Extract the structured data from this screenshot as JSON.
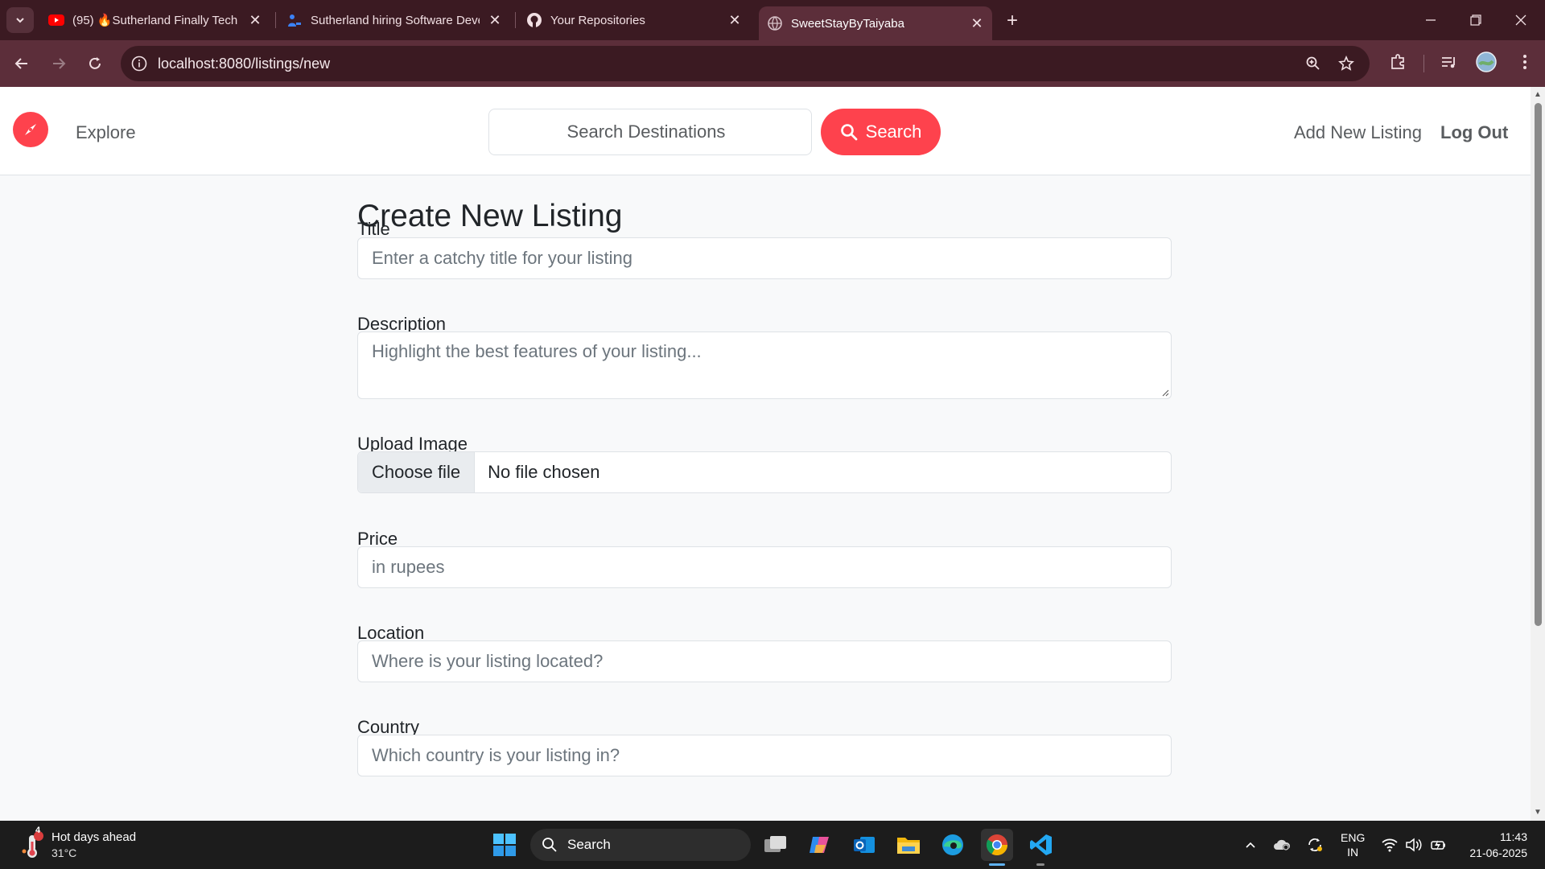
{
  "browser": {
    "tabs": [
      {
        "title": "(95) 🔥Sutherland Finally Tech Hiring",
        "icon": "youtube-icon"
      },
      {
        "title": "Sutherland hiring Software Developer",
        "icon": "job-site-icon"
      },
      {
        "title": "Your Repositories",
        "icon": "github-icon"
      },
      {
        "title": "SweetStayByTaiyaba",
        "icon": "globe-icon"
      }
    ],
    "url": "localhost:8080/listings/new"
  },
  "navbar": {
    "explore": "Explore",
    "search_placeholder": "Search Destinations",
    "search_button": "Search",
    "add_listing": "Add New Listing",
    "logout": "Log Out"
  },
  "form": {
    "heading": "Create New Listing",
    "title_label": "Title",
    "title_placeholder": "Enter a catchy title for your listing",
    "description_label": "Description",
    "description_placeholder": "Highlight the best features of your listing...",
    "image_label": "Upload Image",
    "file_button": "Choose file",
    "file_status": "No file chosen",
    "price_label": "Price",
    "price_placeholder": "in rupees",
    "location_label": "Location",
    "location_placeholder": "Where is your listing located?",
    "country_label": "Country",
    "country_placeholder": "Which country is your listing in?"
  },
  "taskbar": {
    "weather_title": "Hot days ahead",
    "weather_temp": "31°C",
    "weather_badge": "4",
    "search_label": "Search",
    "lang_top": "ENG",
    "lang_bottom": "IN",
    "time": "11:43",
    "date": "21-06-2025"
  },
  "colors": {
    "brand": "#fe424d",
    "chrome_dark": "#3b1a22",
    "chrome_toolbar": "#5c2e3a"
  }
}
